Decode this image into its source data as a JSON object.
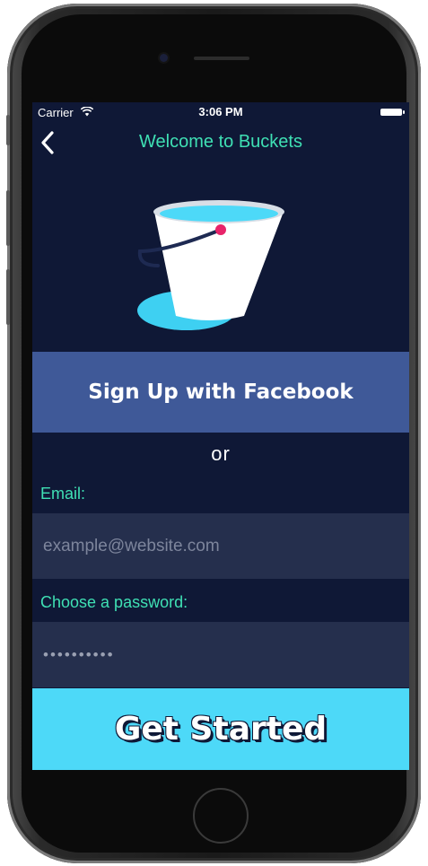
{
  "status_bar": {
    "carrier": "Carrier",
    "time": "3:06 PM",
    "wifi_icon": "wifi-icon",
    "battery_icon": "battery-icon"
  },
  "nav": {
    "back_icon": "chevron-left-icon",
    "title": "Welcome to Buckets"
  },
  "illustration": "bucket-icon",
  "facebook_button": {
    "label": "Sign Up with Facebook"
  },
  "separator_text": "or",
  "email": {
    "label": "Email:",
    "placeholder": "example@website.com",
    "value": ""
  },
  "password": {
    "label": "Choose a password:",
    "value": "••••••••••"
  },
  "cta_button": {
    "label": "Get Started"
  },
  "colors": {
    "background": "#0f1836",
    "accent_green": "#3fe0b4",
    "facebook_blue": "#3f5998",
    "input_bg": "#252f4d",
    "cta_cyan": "#4dd9f8"
  }
}
